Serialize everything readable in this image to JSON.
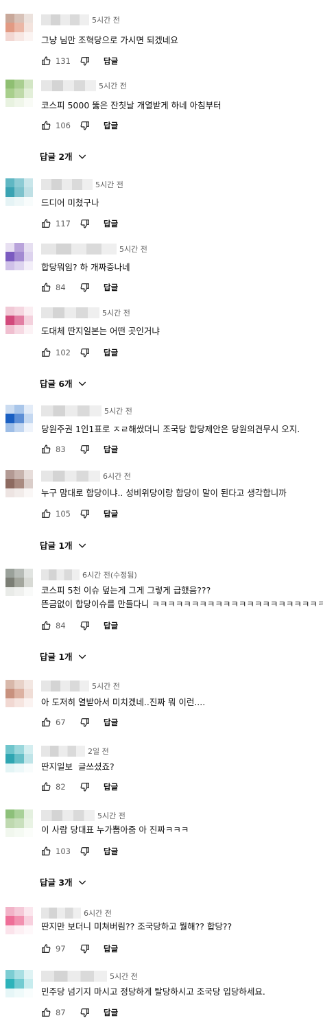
{
  "labels": {
    "reply": "답글"
  },
  "icons": {
    "like": "thumbs-up-icon",
    "dislike": "thumbs-down-icon",
    "expand": "chevron-down-icon"
  },
  "comments": [
    {
      "time": "5시간 전",
      "text": "그냥 님만 조혁당으로 가시면 되겠네요",
      "likes": "131",
      "avatar_colors": [
        "#c9a89a",
        "#d8c2b8",
        "#ece2dd",
        "#e29a83",
        "#ebb7a6",
        "#f4e4de",
        "#f2d7d2",
        "#f7e7e3",
        "#fbf4f2"
      ]
    },
    {
      "time": "5시간 전",
      "text": "코스피 5000 뚫은 잔칫날 개열받게 하네 아침부터",
      "likes": "106",
      "replies": "답글 2개",
      "avatar_colors": [
        "#8fbf72",
        "#a9ce90",
        "#d3e6c5",
        "#a8cf8c",
        "#bfdaa9",
        "#e3efd9",
        "#e8f2e0",
        "#f0f6ea",
        "#f9fbf6"
      ]
    },
    {
      "time": "5시간 전",
      "text": "드디어 미쳤구나",
      "likes": "117",
      "avatar_colors": [
        "#5fb7c3",
        "#8ccbd4",
        "#c9e6ea",
        "#3aa3b3",
        "#7cc2cc",
        "#bfe0e5",
        "#e5f3f5",
        "#eef7f8",
        "#f8fcfc"
      ]
    },
    {
      "time": "5시간 전",
      "text": "합당뭐임? 하 개짜증나네",
      "likes": "84",
      "avatar_colors": [
        "#e8e0f2",
        "#b9a3db",
        "#e6dff1",
        "#7b5bc0",
        "#a38ad2",
        "#ddd3ee",
        "#cfc1e8",
        "#ddd4ef",
        "#f3eff9"
      ]
    },
    {
      "time": "5시간 전",
      "text": "도대체 딴지일본는 어떤 곳인거냐",
      "likes": "102",
      "replies": "답글 6개",
      "avatar_colors": [
        "#f1c9d6",
        "#f5d6e0",
        "#fbeef2",
        "#d24a7c",
        "#e27ea3",
        "#f4d1dd",
        "#f0bfd0",
        "#f6d9e3",
        "#fcf2f5"
      ]
    },
    {
      "time": "5시간 전",
      "text": "당원주권 1인1표로 ㅈㄹ해쌌더니 조국당 합당제안은 당원의견무시 오지.",
      "likes": "83",
      "avatar_colors": [
        "#cbdcf1",
        "#a9c6ea",
        "#e3ecf8",
        "#1a5fc2",
        "#5d8fd6",
        "#c4d8f1",
        "#9dbde6",
        "#c2d6f0",
        "#eef3fb"
      ]
    },
    {
      "time": "6시간 전",
      "text": "누구 맘대로 합당이냐.. 성비위당이랑 합당이 말이 된다고 생각합니까",
      "likes": "105",
      "replies": "답글 1개",
      "avatar_colors": [
        "#b39a94",
        "#c8b4ae",
        "#e7ddda",
        "#8d6a60",
        "#a98a80",
        "#dacdc9",
        "#ede4e2",
        "#f2ecea",
        "#faf7f6"
      ]
    },
    {
      "time": "6시간 전(수정됨)",
      "text": "코스피 5천 이슈 덮는게 그게 그렇게 급했음???",
      "text2": "뜬금없이 합당이슈를 만들다니 ㅋㅋㅋㅋㅋㅋㅋㅋㅋㅋㅋㅋㅋㅋㅋㅋㅋㅋㅋㅋㅋㅋ",
      "likes": "84",
      "replies": "답글 1개",
      "avatar_colors": [
        "#9aa19a",
        "#b7bcb7",
        "#e1e4e1",
        "#7b7e75",
        "#a3a69d",
        "#d8dad5",
        "#e9ebe8",
        "#f0f1ef",
        "#f9faf9"
      ]
    },
    {
      "time": "5시간 전",
      "text": "아 도저히 열받아서 미치겠네..진짜 뭐 이런....",
      "likes": "67",
      "avatar_colors": [
        "#d8b8aa",
        "#e8d2c8",
        "#f3e7e2",
        "#c8917e",
        "#dcb1a1",
        "#f0ddd6",
        "#f1d8d2",
        "#f6e5e0",
        "#fbf3f1"
      ]
    },
    {
      "time": "2일 전",
      "text": "딴지일보  글쓰셨죠?",
      "likes": "82",
      "avatar_colors": [
        "#6fc5cc",
        "#9ad7dc",
        "#d4eef0",
        "#2fa6b2",
        "#66bfc7",
        "#bfe4e8",
        "#e3f4f5",
        "#edf8f9",
        "#f8fcfc"
      ]
    },
    {
      "time": "5시간 전",
      "text": "이 사람 당대표 누가뽑아줌 아 진짜ㅋㅋㅋ",
      "likes": "103",
      "replies": "답글 3개",
      "avatar_colors": [
        "#8dc07a",
        "#a9d199",
        "#e4f0df",
        "#bfd9b0",
        "#c9e0bd",
        "#e9f3e4",
        "#f1f7ee",
        "#f5faf3",
        "#fbfdfa"
      ]
    },
    {
      "time": "6시간 전",
      "text": "딴지만 보더니 미쳐버림?? 조국당하고 뭘해?? 합당??",
      "likes": "97",
      "avatar_colors": [
        "#f2b3c8",
        "#f5c9d8",
        "#fbe7ee",
        "#ee6f98",
        "#f291b0",
        "#f8d0de",
        "#fbe3eb",
        "#fdf0f4",
        "#fef8fa"
      ]
    },
    {
      "time": "5시간 전",
      "text": "민주당 넘기지 마시고 정당하게 탈당하시고 조국당 입당하세요.",
      "likes": "87",
      "avatar_colors": [
        "#7ccdd3",
        "#a9dfe3",
        "#dff3f4",
        "#2db3ba",
        "#71cbd1",
        "#c7ecee",
        "#e6f6f7",
        "#effafa",
        "#f9fdfd"
      ]
    }
  ]
}
